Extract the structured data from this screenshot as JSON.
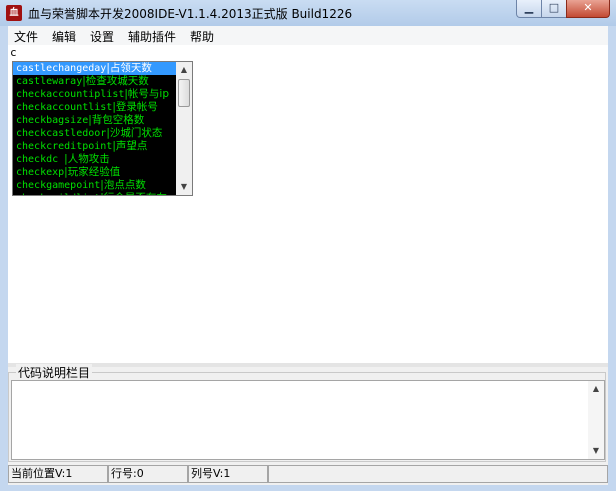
{
  "window": {
    "title": "血与荣誉脚本开发2008IDE-V1.1.4.2013正式版 Build1226",
    "icon_text": "血",
    "min_glyph": "▁",
    "max_glyph": "□",
    "close_glyph": "✕"
  },
  "menu": {
    "items": [
      "文件",
      "编辑",
      "设置",
      "辅助插件",
      "帮助"
    ]
  },
  "editor": {
    "content": "c"
  },
  "autocomplete": {
    "items": [
      {
        "kw": "castlechangeday",
        "desc": "|占领天数",
        "selected": true
      },
      {
        "kw": "castlewaray",
        "desc": "|检查攻城天数",
        "selected": false
      },
      {
        "kw": "checkaccountiplist",
        "desc": "|帐号与ip",
        "selected": false
      },
      {
        "kw": "checkaccountlist",
        "desc": "|登录帐号",
        "selected": false
      },
      {
        "kw": "checkbagsize",
        "desc": "|背包空格数",
        "selected": false
      },
      {
        "kw": "checkcastledoor",
        "desc": "|沙城门状态",
        "selected": false
      },
      {
        "kw": "checkcreditpoint",
        "desc": "|声望点",
        "selected": false
      },
      {
        "kw": "checkdc ",
        "desc": "|人物攻击",
        "selected": false
      },
      {
        "kw": "checkexp",
        "desc": "|玩家经验值",
        "selected": false
      },
      {
        "kw": "checkgamepoint",
        "desc": "|泡点点数",
        "selected": false
      },
      {
        "kw": "checkguildlist",
        "desc": "|行会是否存在",
        "selected": false
      }
    ],
    "scroll_up": "▲",
    "scroll_down": "▼"
  },
  "description_panel": {
    "label": "代码说明栏目"
  },
  "statusbar": {
    "position": "当前位置V:1",
    "line": "行号:0",
    "column": "列号V:1",
    "extra": ""
  },
  "colors": {
    "autocomplete_bg": "#000000",
    "autocomplete_text": "#00e000",
    "selection": "#3399ff",
    "close_button": "#c34a33"
  }
}
